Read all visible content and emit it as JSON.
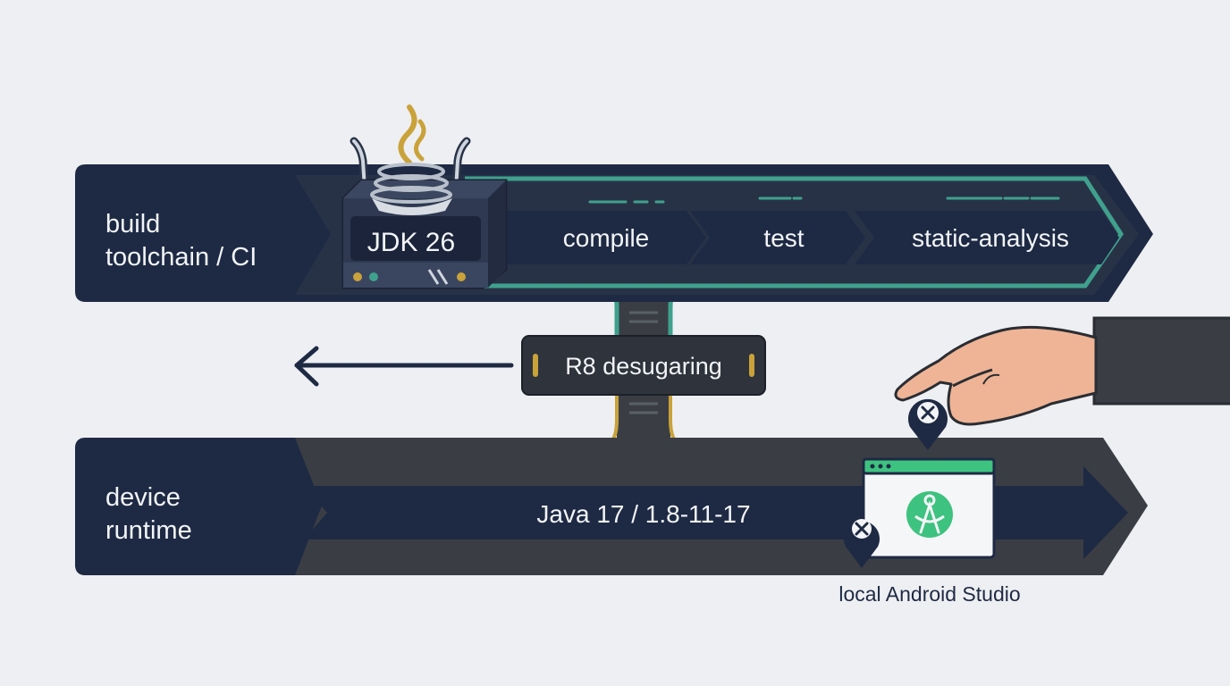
{
  "build_lane": {
    "label_line1": "build",
    "label_line2": "toolchain / CI",
    "jdk_label": "JDK 26",
    "stages": [
      "compile",
      "test",
      "static-analysis"
    ]
  },
  "bridge": {
    "label": "R8 desugaring"
  },
  "runtime_lane": {
    "label_line1": "device",
    "label_line2": "runtime",
    "versions_label": "Java 17 / 1.8-11-17"
  },
  "local_tool": {
    "caption": "local Android Studio"
  },
  "colors": {
    "lane_dark": "#1e2a44",
    "lane_gray": "#3a3e44",
    "accent_teal": "#3fa18d",
    "accent_gold": "#c9a23a",
    "android_green": "#3ec27f",
    "hand_skin": "#eeb495",
    "background": "#eeeff2"
  },
  "icons": [
    "java-coffee-cup-icon",
    "server-box-icon",
    "left-arrow-icon",
    "close-pin-icon",
    "android-studio-icon",
    "hand-icon"
  ]
}
